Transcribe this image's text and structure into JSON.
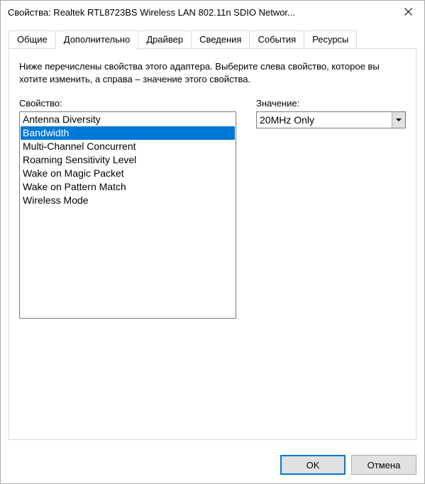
{
  "window": {
    "title": "Свойства: Realtek RTL8723BS Wireless LAN 802.11n SDIO Networ..."
  },
  "tabs": [
    {
      "label": "Общие"
    },
    {
      "label": "Дополнительно"
    },
    {
      "label": "Драйвер"
    },
    {
      "label": "Сведения"
    },
    {
      "label": "События"
    },
    {
      "label": "Ресурсы"
    }
  ],
  "panel": {
    "description": "Ниже перечислены свойства этого адаптера. Выберите слева свойство, которое вы хотите изменить, а справа – значение этого свойства.",
    "property_label": "Свойство:",
    "value_label": "Значение:",
    "properties": [
      "Antenna Diversity",
      "Bandwidth",
      "Multi-Channel Concurrent",
      "Roaming Sensitivity Level",
      "Wake on Magic Packet",
      "Wake on Pattern Match",
      "Wireless Mode"
    ],
    "selected_property_index": 1,
    "value": "20MHz Only"
  },
  "buttons": {
    "ok": "OK",
    "cancel": "Отмена"
  }
}
